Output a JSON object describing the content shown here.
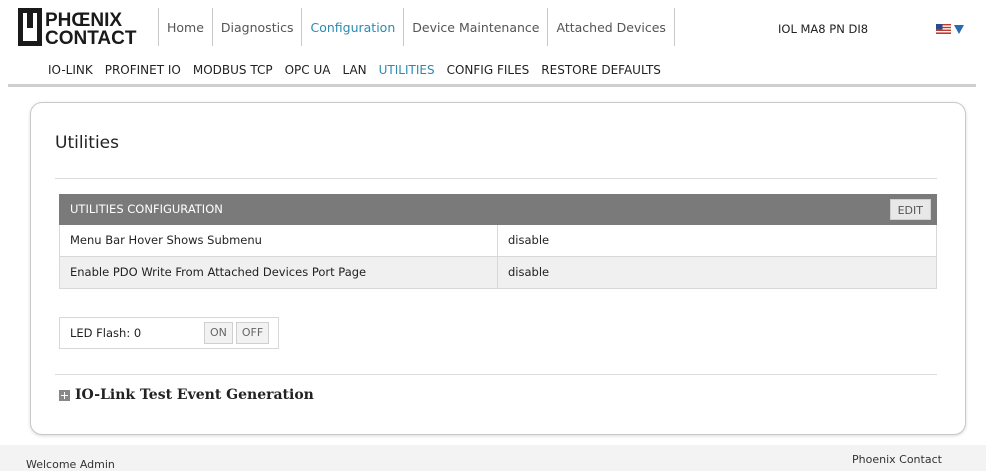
{
  "logo": {
    "line1": "PHŒNIX",
    "line2": "CONTACT"
  },
  "nav": {
    "items": [
      {
        "label": "Home",
        "active": false
      },
      {
        "label": "Diagnostics",
        "active": false
      },
      {
        "label": "Configuration",
        "active": true
      },
      {
        "label": "Device Maintenance",
        "active": false
      },
      {
        "label": "Attached Devices",
        "active": false
      }
    ],
    "device_name": "IOL MA8 PN DI8",
    "language_flag": "us-flag-icon"
  },
  "subnav": {
    "items": [
      {
        "label": "IO-LINK",
        "active": false
      },
      {
        "label": "PROFINET IO",
        "active": false
      },
      {
        "label": "MODBUS TCP",
        "active": false
      },
      {
        "label": "OPC UA",
        "active": false
      },
      {
        "label": "LAN",
        "active": false
      },
      {
        "label": "UTILITIES",
        "active": true
      },
      {
        "label": "CONFIG FILES",
        "active": false
      },
      {
        "label": "RESTORE DEFAULTS",
        "active": false
      }
    ]
  },
  "main": {
    "title": "Utilities",
    "config_table": {
      "header": "UTILITIES CONFIGURATION",
      "edit_label": "EDIT",
      "rows": [
        {
          "key": "Menu Bar Hover Shows Submenu",
          "value": "disable"
        },
        {
          "key": "Enable PDO Write From Attached Devices Port Page",
          "value": "disable"
        }
      ]
    },
    "led_flash": {
      "label": "LED Flash: 0",
      "on_label": "ON",
      "off_label": "OFF"
    },
    "event_section": {
      "title": "IO-Link Test Event Generation"
    }
  },
  "footer": {
    "welcome": "Welcome Admin",
    "brand": "Phoenix Contact"
  },
  "colors": {
    "accent": "#2a8ab0",
    "table_header": "#7a7a7a"
  }
}
